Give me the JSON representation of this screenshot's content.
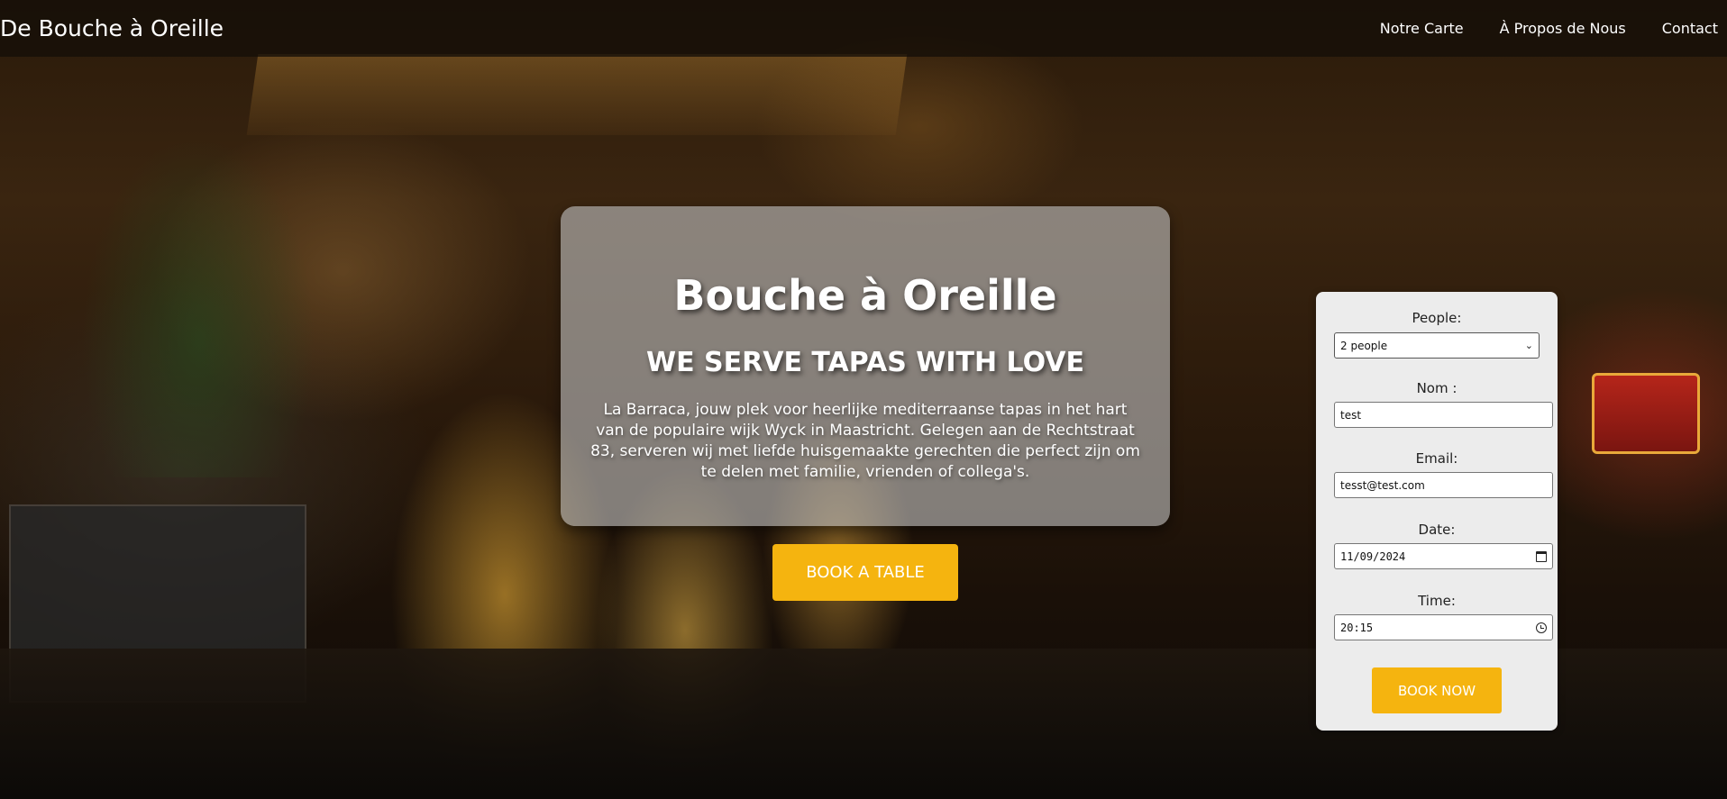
{
  "navbar": {
    "brand": "De Bouche à Oreille",
    "links": [
      "Notre Carte",
      "À Propos de Nous",
      "Contact"
    ]
  },
  "hero": {
    "title": "Bouche à Oreille",
    "subtitle": "WE SERVE TAPAS WITH LOVE",
    "description": "La Barraca, jouw plek voor heerlijke mediterraanse tapas in het hart van de populaire wijk Wyck in Maastricht. Gelegen aan de Rechtstraat 83, serveren wij met liefde huisgemaakte gerechten die perfect zijn om te delen met familie, vrienden of collega's.",
    "cta_label": "BOOK A TABLE"
  },
  "reservation": {
    "people_label": "People:",
    "people_value": "2 people",
    "name_label": "Nom :",
    "name_value": "test",
    "email_label": "Email:",
    "email_value": "tesst@test.com",
    "date_label": "Date:",
    "date_value": "11/09/2024",
    "time_label": "Time:",
    "time_value": "20:15",
    "submit_label": "BOOK NOW"
  },
  "colors": {
    "accent": "#f5b40f",
    "navbar_bg": "#140e08",
    "card_bg": "#bebebe",
    "form_bg": "#ececec"
  },
  "icons": {
    "select": "chevron-down-icon",
    "date": "calendar-icon",
    "time": "clock-icon"
  }
}
